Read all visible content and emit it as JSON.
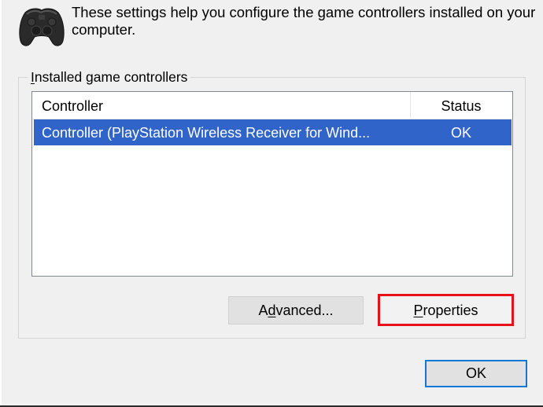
{
  "header": {
    "icon": "gamepad-icon",
    "text": "These settings help you configure the game controllers installed on your computer."
  },
  "group": {
    "label_underlined": "I",
    "label_rest": "nstalled game controllers"
  },
  "list": {
    "columns": {
      "controller": "Controller",
      "status": "Status"
    },
    "rows": [
      {
        "name": "Controller (PlayStation Wireless Receiver for Wind...",
        "status": "OK",
        "selected": true
      }
    ],
    "selection_color": "#3064c8"
  },
  "buttons": {
    "advanced": {
      "before": "A",
      "underlined": "d",
      "after": "vanced..."
    },
    "properties": {
      "before": "",
      "underlined": "P",
      "after": "roperties",
      "highlight_color": "#e8101a"
    },
    "ok": {
      "label": "OK"
    }
  }
}
